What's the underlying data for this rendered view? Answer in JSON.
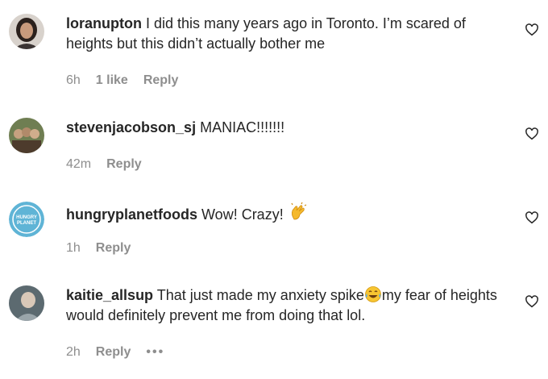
{
  "comments": [
    {
      "username": "loranupton",
      "text": "I did this many years ago in Toronto. I’m scared of heights but this didn’t actually bother me",
      "time": "6h",
      "likes": "1 like",
      "reply": "Reply",
      "avatar_icon": "profile-photo-woman"
    },
    {
      "username": "stevenjacobson_sj",
      "text": "MANIAC!!!!!!!",
      "time": "42m",
      "reply": "Reply",
      "avatar_icon": "profile-photo-group"
    },
    {
      "username": "hungryplanetfoods",
      "text": "Wow! Crazy!",
      "text_emoji": "clapping-hands-emoji",
      "time": "1h",
      "reply": "Reply",
      "avatar_icon": "hungry-planet-logo",
      "avatar_logo_text": [
        "HUNGRY",
        "PLANET"
      ]
    },
    {
      "username": "kaitie_allsup",
      "text_before": "That just made my anxiety spike",
      "text_emoji": "tears-of-joy-emoji",
      "text_after": "my fear of heights would definitely prevent me from doing that lol.",
      "time": "2h",
      "reply": "Reply",
      "more": "•••",
      "avatar_icon": "profile-photo-person"
    }
  ],
  "colors": {
    "text": "#262626",
    "meta": "#8e8e8e",
    "logo_bg": "#5fb4d6"
  },
  "icons": {
    "like": "heart-outline-icon"
  }
}
